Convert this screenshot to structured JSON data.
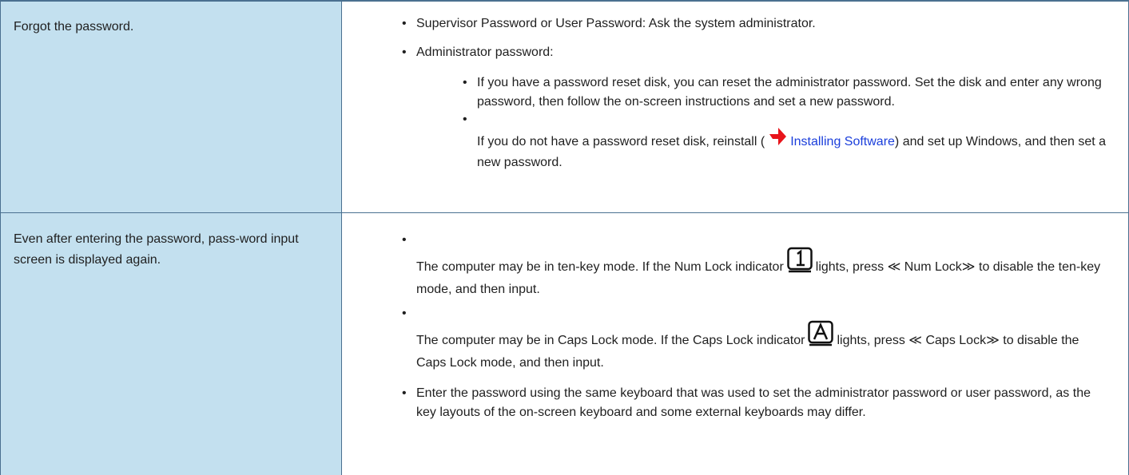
{
  "rows": [
    {
      "problem": "Forgot the password.",
      "items": {
        "supervisor": "Supervisor Password or User Password: Ask the system administrator.",
        "admin": "Administrator password:",
        "reset_disk": "If you have a password reset disk, you can reset the administrator password. Set the disk and enter any wrong password, then follow the on-screen instructions and set a new password.",
        "no_disk_before": "If you do not have a password reset disk, reinstall (",
        "no_disk_link": "Installing Software",
        "no_disk_after": ") and set up Windows, and then set a new password."
      }
    },
    {
      "problem": "Even after entering the password, pass-word input screen is displayed again.",
      "items": {
        "numlock_before": "The computer may be in ten-key mode. If the Num Lock indicator",
        "numlock_after": "lights, press ≪ Num Lock≫ to disable the ten-key mode, and then input.",
        "capslock_before": "The computer may be in Caps Lock mode. If the Caps Lock indicator",
        "capslock_after": "lights, press ≪ Caps Lock≫ to disable the Caps Lock mode, and then input.",
        "keyboard": "Enter the password using the same keyboard that was used to set the administrator password or user password, as the key layouts of the on-screen keyboard and some external keyboards may differ."
      }
    }
  ],
  "icons": {
    "link_arrow": "red-arrow-icon",
    "numlock": "num-lock-indicator-icon",
    "capslock": "caps-lock-indicator-icon",
    "arrow_color": "#e8141b"
  }
}
